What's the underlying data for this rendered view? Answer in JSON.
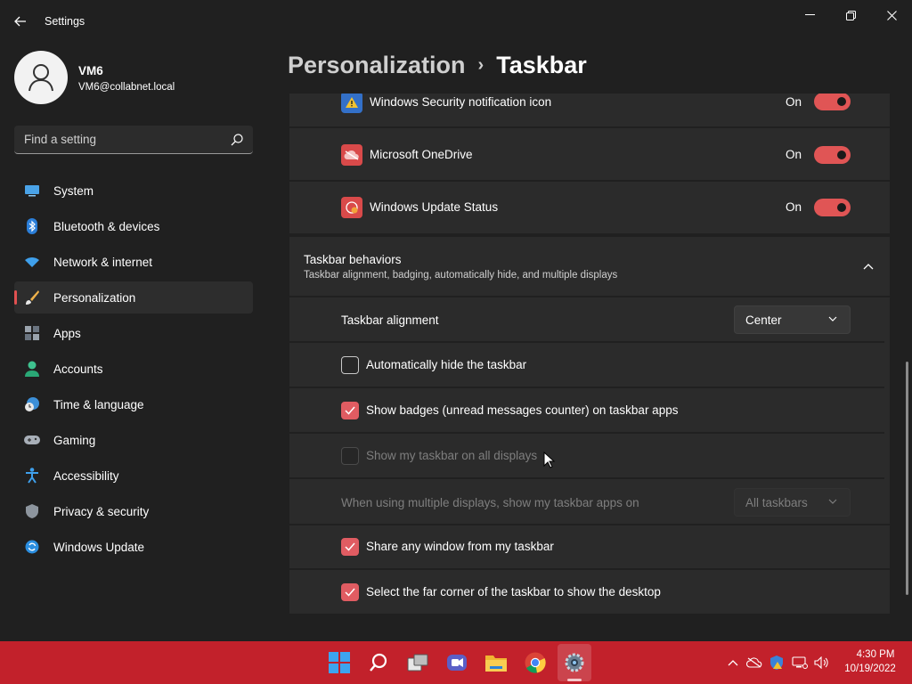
{
  "window": {
    "title": "Settings"
  },
  "profile": {
    "name": "VM6",
    "email": "VM6@collabnet.local"
  },
  "search": {
    "placeholder": "Find a setting"
  },
  "nav": {
    "items": [
      {
        "label": "System",
        "icon": "monitor-icon"
      },
      {
        "label": "Bluetooth & devices",
        "icon": "bluetooth-icon"
      },
      {
        "label": "Network & internet",
        "icon": "wifi-icon"
      },
      {
        "label": "Personalization",
        "icon": "paintbrush-icon",
        "active": true
      },
      {
        "label": "Apps",
        "icon": "apps-icon"
      },
      {
        "label": "Accounts",
        "icon": "person-icon"
      },
      {
        "label": "Time & language",
        "icon": "clock-globe-icon"
      },
      {
        "label": "Gaming",
        "icon": "gamepad-icon"
      },
      {
        "label": "Accessibility",
        "icon": "accessibility-icon"
      },
      {
        "label": "Privacy & security",
        "icon": "shield-icon"
      },
      {
        "label": "Windows Update",
        "icon": "update-icon"
      }
    ]
  },
  "header": {
    "parent": "Personalization",
    "separator": "›",
    "current": "Taskbar"
  },
  "tray_icons": {
    "items": [
      {
        "label": "Windows Security notification icon",
        "state": "On",
        "toggle_on": true,
        "icon": "windows-security-icon"
      },
      {
        "label": "Microsoft OneDrive",
        "state": "On",
        "toggle_on": true,
        "icon": "onedrive-icon"
      },
      {
        "label": "Windows Update Status",
        "state": "On",
        "toggle_on": true,
        "icon": "windows-update-status-icon"
      }
    ]
  },
  "behaviors": {
    "title": "Taskbar behaviors",
    "subtitle": "Taskbar alignment, badging, automatically hide, and multiple displays",
    "alignment_label": "Taskbar alignment",
    "alignment_value": "Center",
    "auto_hide_label": "Automatically hide the taskbar",
    "auto_hide_checked": false,
    "badges_label": "Show badges (unread messages counter) on taskbar apps",
    "badges_checked": true,
    "all_displays_label": "Show my taskbar on all displays",
    "all_displays_checked": false,
    "all_displays_enabled": false,
    "multi_display_label": "When using multiple displays, show my taskbar apps on",
    "multi_display_value": "All taskbars",
    "multi_display_enabled": false,
    "share_window_label": "Share any window from my taskbar",
    "share_window_checked": true,
    "far_corner_label": "Select the far corner of the taskbar to show the desktop",
    "far_corner_checked": true
  },
  "taskbar": {
    "pinned": [
      "start-icon",
      "search-icon",
      "task-view-icon",
      "teams-chat-icon",
      "file-explorer-icon",
      "chrome-icon",
      "settings-icon"
    ],
    "active_app": "settings-icon",
    "clock_time": "4:30 PM",
    "clock_date": "10/19/2022",
    "tray": [
      "chevron-up-icon",
      "onedrive-tray-icon",
      "security-tray-icon",
      "network-tray-icon",
      "volume-icon"
    ]
  },
  "colors": {
    "accent": "#e05555",
    "taskbar": "#c2212b",
    "background": "#202020",
    "card": "#2b2b2b"
  }
}
